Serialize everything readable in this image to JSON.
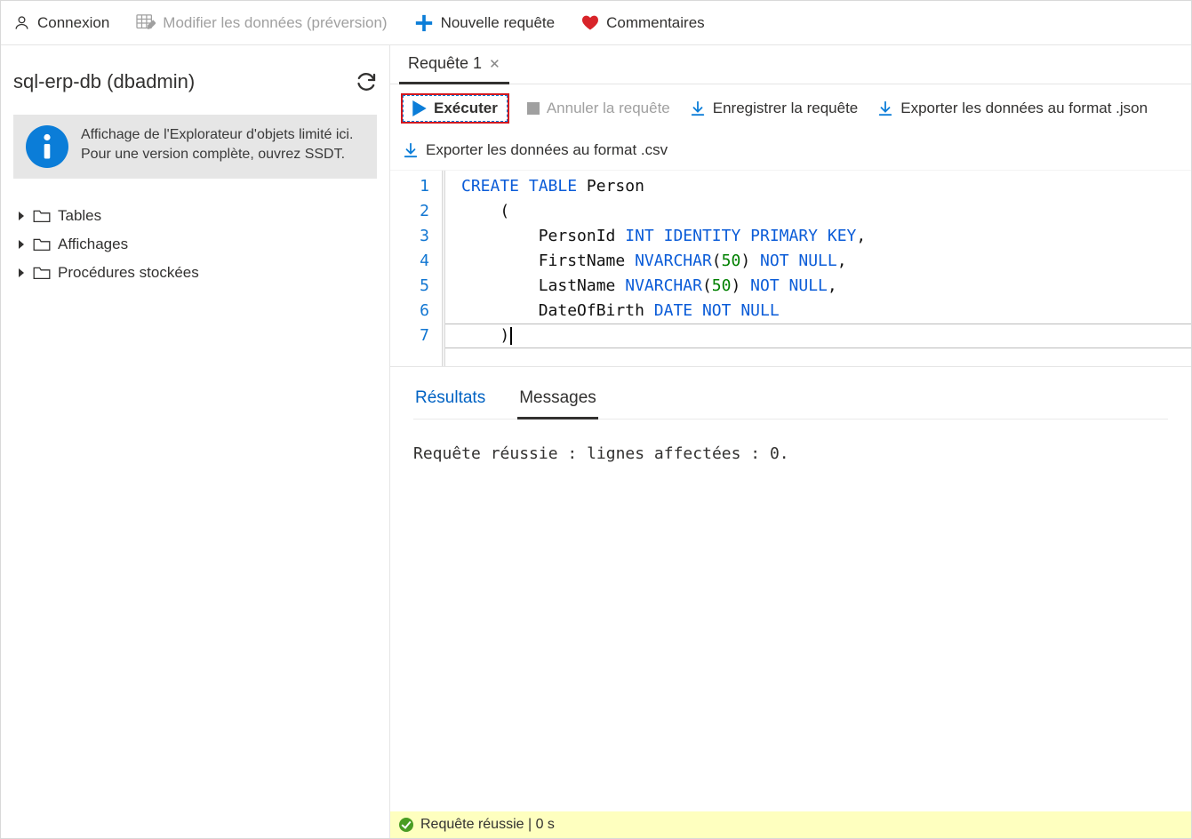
{
  "topbar": {
    "login": "Connexion",
    "edit_data": "Modifier les données (préversion)",
    "new_query": "Nouvelle requête",
    "feedback": "Commentaires"
  },
  "sidebar": {
    "db_label": "sql-erp-db (dbadmin)",
    "info_text": "Affichage de l'Explorateur d'objets limité ici. Pour une version complète, ouvrez SSDT.",
    "tree": {
      "tables": "Tables",
      "views": "Affichages",
      "procs": "Procédures stockées"
    }
  },
  "tab": {
    "title": "Requête 1"
  },
  "actions": {
    "run": "Exécuter",
    "cancel": "Annuler la requête",
    "save": "Enregistrer la requête",
    "export_json": "Exporter les données au format .json",
    "export_csv": "Exporter les données au format .csv"
  },
  "editor": {
    "lines": [
      "1",
      "2",
      "3",
      "4",
      "5",
      "6",
      "7"
    ]
  },
  "results": {
    "tab_results": "Résultats",
    "tab_messages": "Messages",
    "message": "Requête réussie : lignes affectées : 0."
  },
  "status": {
    "text": "Requête réussie | 0 s"
  }
}
